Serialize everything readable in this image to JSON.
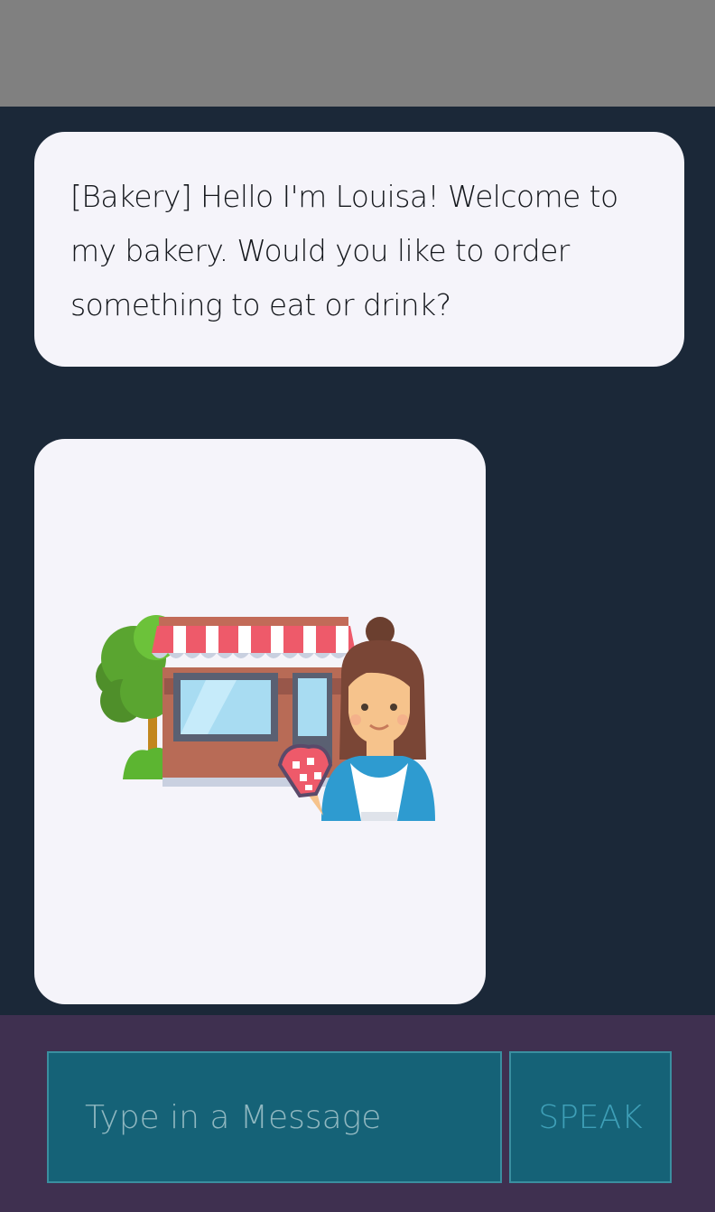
{
  "chat": {
    "messages": [
      {
        "text": "[Bakery] Hello I'm Louisa! Welcome to my bakery. Would you like to order something to eat or drink?"
      },
      {
        "image": "bakery-with-baker-illustration"
      }
    ]
  },
  "composer": {
    "placeholder": "Type in a Message",
    "value": "",
    "speak_label": "SPEAK"
  },
  "colors": {
    "status_bar": "#808080",
    "chat_background": "#1b2838",
    "bubble": "#f5f4fa",
    "composer_background": "#3f3050",
    "input_background": "#156277",
    "speak_text": "#3e9fb7"
  }
}
